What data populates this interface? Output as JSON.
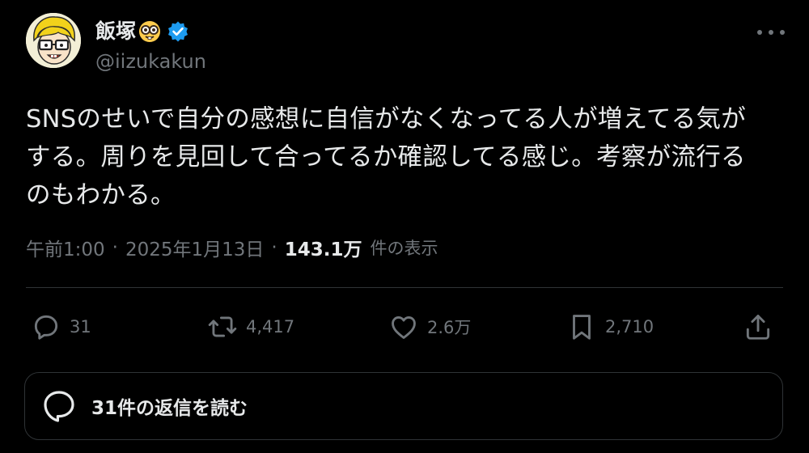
{
  "author": {
    "display_name": "飯塚",
    "handle": "@iizukakun",
    "emoji_icon": "nerd-face-icon",
    "verified_icon": "verified-badge-icon",
    "verified_color": "#1d9bf0"
  },
  "tweet": {
    "text": "SNSのせいで自分の感想に自信がなくなってる人が増えてる気が\nする。周りを見回して合ってるか確認してる感じ。考察が流行る\nのもわかる。"
  },
  "meta": {
    "time": "午前1:00",
    "separator": "·",
    "date": "2025年1月13日",
    "views_count": "143.1万",
    "views_label": "件の表示"
  },
  "actions": {
    "reply": {
      "icon": "reply-icon",
      "count": "31"
    },
    "retweet": {
      "icon": "retweet-icon",
      "count": "4,417"
    },
    "like": {
      "icon": "heart-icon",
      "count": "2.6万"
    },
    "bookmark": {
      "icon": "bookmark-icon",
      "count": "2,710"
    },
    "share": {
      "icon": "share-icon"
    }
  },
  "replies_button": {
    "icon": "chat-bubble-icon",
    "label": "31件の返信を読む"
  },
  "colors": {
    "background": "#000000",
    "primary_text": "#e7e9ea",
    "secondary_text": "#71767b",
    "divider": "#2f3336"
  }
}
